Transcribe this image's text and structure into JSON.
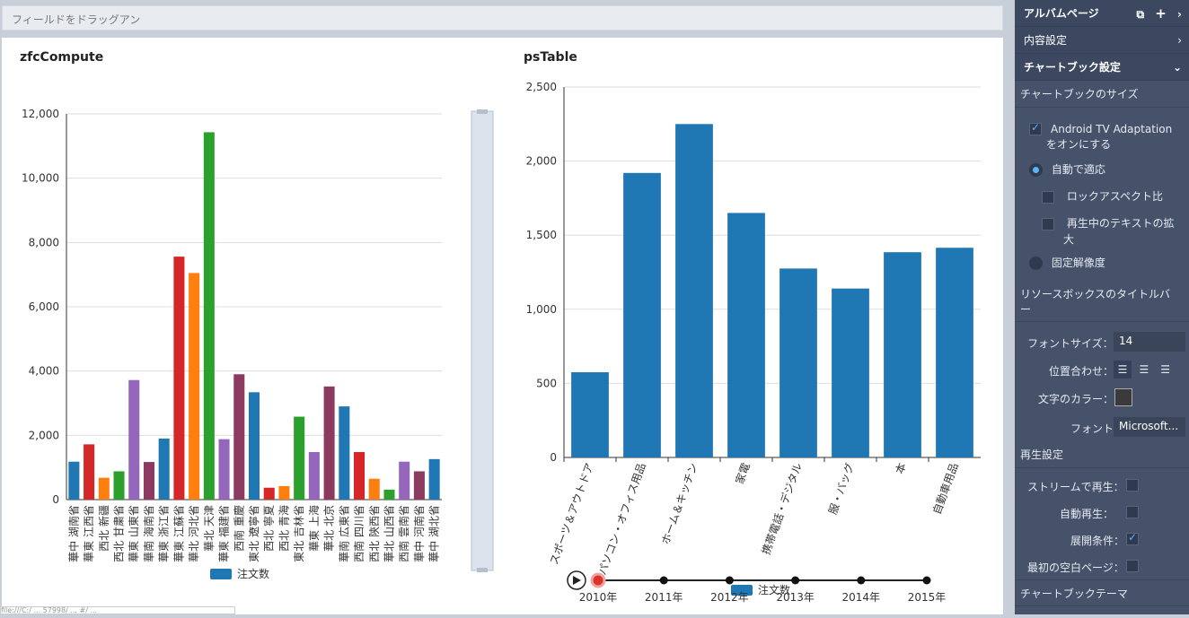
{
  "dropbar_text": "フィールドをドラッグアン",
  "status_text": "file:///C:/ ... 57998/ ... #/ ... ",
  "chart_data": [
    {
      "type": "bar",
      "title": "zfcCompute",
      "ylim": [
        0,
        12000
      ],
      "yticks": [
        "0",
        "2,000",
        "4,000",
        "6,000",
        "8,000",
        "10,000",
        "12,000"
      ],
      "categories": [
        "華中 湖南省",
        "華東 江西省",
        "西北 新疆",
        "西北 甘粛省",
        "華東 山東省",
        "華南 海南省",
        "華東 浙江省",
        "華東 江蘇省",
        "華北 河北省",
        "華北 天津",
        "華東 福建省",
        "西南 重慶",
        "東北 遼寧省",
        "西北 寧夏",
        "西北 青海",
        "東北 吉林省",
        "華東 上海",
        "華北 北京",
        "華南 広東省",
        "西南 四川省",
        "西北 陝西省",
        "華北 山西省",
        "西南 雲南省",
        "華中 河南省",
        "華中 湖北省"
      ],
      "values": [
        1180,
        1720,
        680,
        880,
        3720,
        1170,
        1900,
        7560,
        7050,
        11430,
        1880,
        3900,
        3340,
        370,
        420,
        2580,
        1480,
        3520,
        2900,
        1480,
        650,
        310,
        1180,
        880,
        1260
      ],
      "colors": [
        "#1f77b4",
        "#d62728",
        "#ff7f0e",
        "#2ca02c",
        "#9467bd",
        "#8c3a5f",
        "#1f77b4",
        "#d62728",
        "#ff7f0e",
        "#2ca02c",
        "#9467bd",
        "#8c3a5f",
        "#1f77b4",
        "#d62728",
        "#ff7f0e",
        "#2ca02c",
        "#9467bd",
        "#8c3a5f",
        "#1f77b4",
        "#d62728",
        "#ff7f0e",
        "#2ca02c",
        "#9467bd",
        "#8c3a5f",
        "#1f77b4"
      ],
      "legend": "注文数",
      "grid": true
    },
    {
      "type": "bar",
      "title": "psTable",
      "ylim": [
        0,
        2500
      ],
      "yticks": [
        "0",
        "500",
        "1,000",
        "1,500",
        "2,000",
        "2,500"
      ],
      "categories": [
        "スポーツ＆アウトドア",
        "パソコン・オフィス用品",
        "ホーム＆キッチン",
        "家電",
        "携帯電話・デジタル",
        "服・バッグ",
        "本",
        "自動車用品"
      ],
      "values": [
        575,
        1920,
        2250,
        1650,
        1275,
        1140,
        1385,
        1415
      ],
      "color": "#1f77b4",
      "legend": "注文数",
      "timeline": [
        "2010年",
        "2011年",
        "2012年",
        "2013年",
        "2014年",
        "2015年"
      ],
      "grid": true
    }
  ],
  "panel": {
    "album_page": "アルバムページ",
    "content_settings": "内容設定",
    "chartbook_settings": "チャートブック設定",
    "chartbook_size": "チャートブックのサイズ",
    "android_tv_line1": "Android TV Adaptation",
    "android_tv_line2": "をオンにする",
    "auto_fit": "自動で適応",
    "lock_aspect": "ロックアスペクト比",
    "text_scale_line1": "再生中のテキストの拡",
    "text_scale_line2": "大",
    "fixed_resolution": "固定解像度",
    "resource_title_line1": "リソースボックスのタイトルバ",
    "resource_title_line2": "ー",
    "font_size_label": "フォントサイズ：",
    "font_size_value": "14",
    "align_label": "位置合わせ：",
    "text_color_label": "文字のカラー：",
    "font_label": "フォント：",
    "font_value": "Microsoft...",
    "playback_settings": "再生設定",
    "stream_play": "ストリームで再生：",
    "auto_play": "自動再生：",
    "expand_condition": "展開条件：",
    "first_blank_page": "最初の空白ページ：",
    "chartbook_theme": "チャートブックテーマ"
  }
}
